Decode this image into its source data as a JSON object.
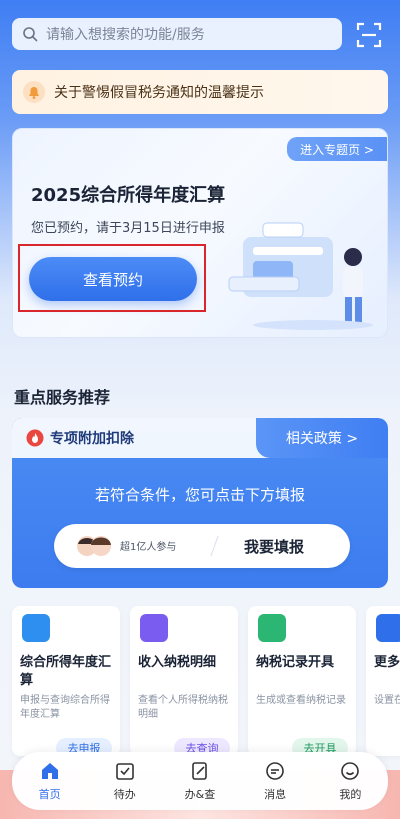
{
  "search": {
    "placeholder": "请输入想搜索的功能/服务"
  },
  "notice": {
    "text": "关于警惕假冒税务通知的温馨提示"
  },
  "annual_card": {
    "topic_link": "进入专题页 >",
    "title": "2025综合所得年度汇算",
    "subtitle": "您已预约，请于3月15日进行申报",
    "button": "查看预约"
  },
  "section": {
    "title": "重点服务推荐"
  },
  "deduction": {
    "label": "专项附加扣除",
    "policy_link": "相关政策 >",
    "message": "若符合条件，您可点击下方填报",
    "participants": "超1亿人参与",
    "fill_button": "我要填报"
  },
  "services": [
    {
      "title": "综合所得年度汇算",
      "desc": "申报与查询综合所得年度汇算",
      "btn": "去申报",
      "color": "#2f8ff0"
    },
    {
      "title": "收入纳税明细",
      "desc": "查看个人所得税纳税明细",
      "btn": "去查询",
      "color": "#7a5cf0"
    },
    {
      "title": "纳税记录开具",
      "desc": "生成或查看纳税记录",
      "btn": "去开具",
      "color": "#2bb673"
    },
    {
      "title": "更多功",
      "desc": "设置在常用功",
      "btn": "",
      "color": "#2f6fe9"
    }
  ],
  "nav": [
    {
      "label": "首页",
      "icon": "home-icon"
    },
    {
      "label": "待办",
      "icon": "calendar-check-icon"
    },
    {
      "label": "办&查",
      "icon": "document-edit-icon"
    },
    {
      "label": "消息",
      "icon": "message-icon"
    },
    {
      "label": "我的",
      "icon": "profile-icon"
    }
  ]
}
